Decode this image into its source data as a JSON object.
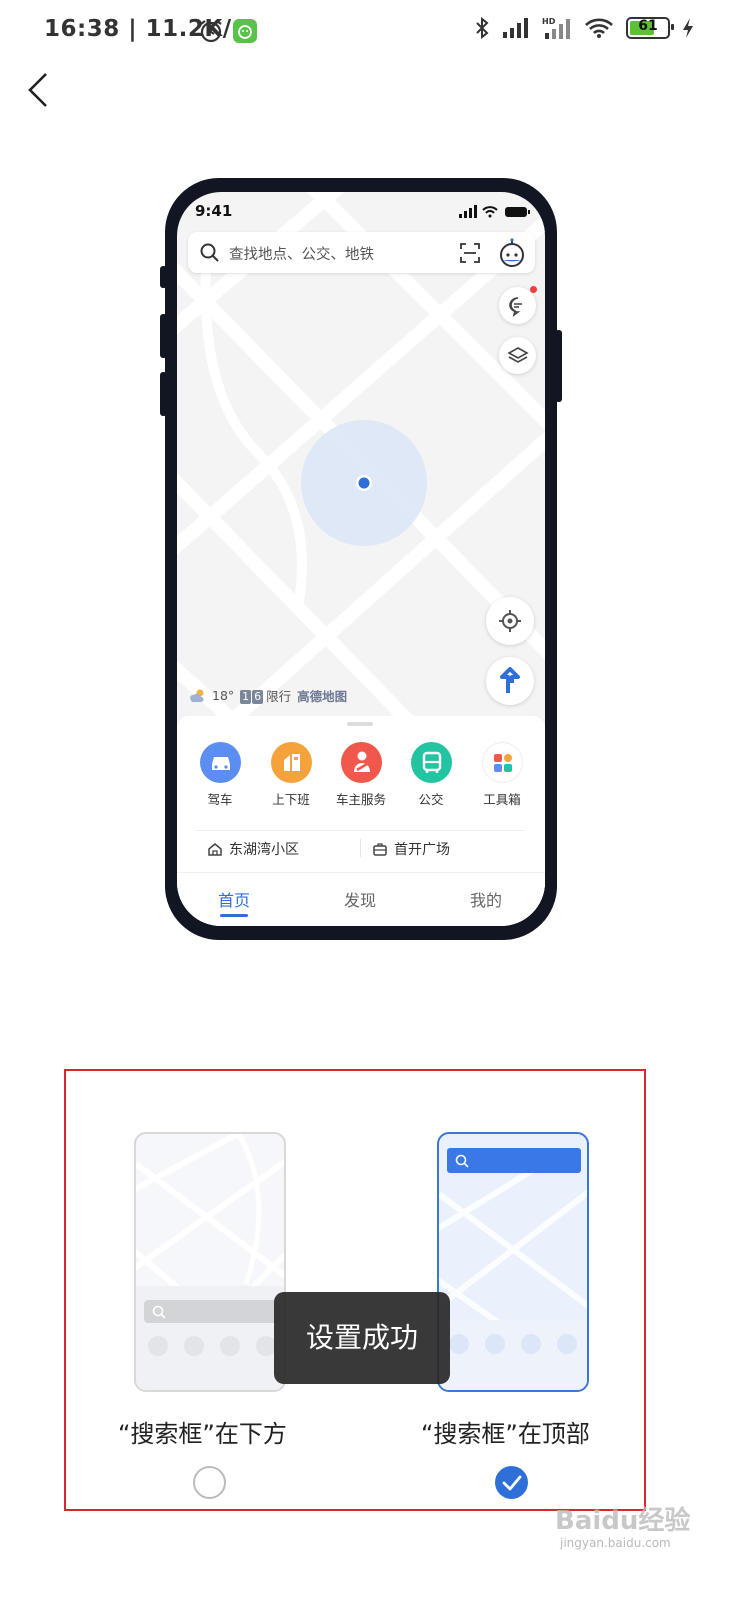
{
  "status_bar": {
    "time": "16:38 | 11.2K/s",
    "battery": "61"
  },
  "phone_preview": {
    "time": "9:41",
    "search_placeholder": "查找地点、公交、地铁",
    "weather": {
      "temp": "18°",
      "plates": [
        "1",
        "6"
      ],
      "restriction": "限行",
      "brand": "高德地图"
    },
    "quick_actions": [
      {
        "label": "驾车",
        "color": "#5b8ef0"
      },
      {
        "label": "上下班",
        "color": "#f5a23a"
      },
      {
        "label": "车主服务",
        "color": "#f0584b"
      },
      {
        "label": "公交",
        "color": "#23c4a2"
      },
      {
        "label": "工具箱",
        "color": "#ffffff"
      }
    ],
    "places": [
      "东湖湾小区",
      "首开广场"
    ],
    "tabs": [
      "首页",
      "发现",
      "我的"
    ],
    "active_tab": 0
  },
  "options": {
    "bottom_label": "“搜索框”在下方",
    "top_label": "“搜索框”在顶部",
    "selected": "top"
  },
  "toast": "设置成功",
  "watermark": {
    "text": "Baidu经验",
    "url": "jingyan.baidu.com"
  }
}
